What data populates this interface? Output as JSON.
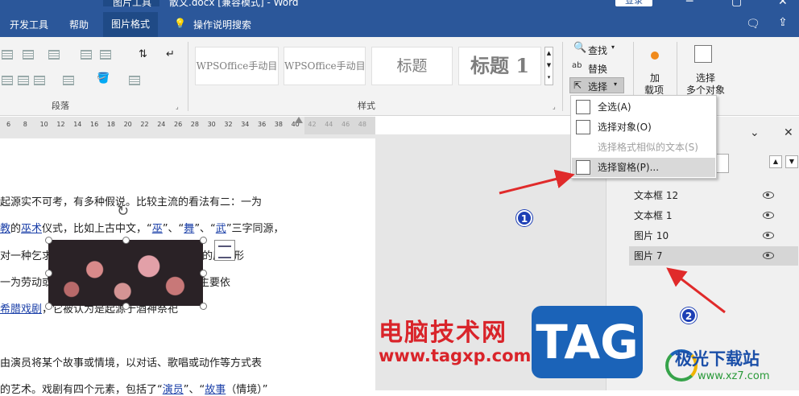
{
  "titlebar": {
    "title": "散文.docx [兼容模式] - Word",
    "context_tab": "图片工具",
    "login": "登录"
  },
  "tabs": [
    "开发工具",
    "帮助",
    "图片格式",
    "操作说明搜索"
  ],
  "ribbon": {
    "paragraph_label": "段落",
    "styles_label": "样式",
    "styles": [
      "WPSOffice手动目",
      "WPSOffice手动目",
      "标题",
      "标题 1"
    ],
    "find": "查找",
    "replace": "替换",
    "select": "选择",
    "addin_line1": "加",
    "addin_line2": "载项",
    "select_multi_line1": "选择",
    "select_multi_line2": "多个对象"
  },
  "ruler": {
    "ticks": [
      "6",
      "8",
      "10",
      "12",
      "14",
      "16",
      "18",
      "20",
      "22",
      "24",
      "26",
      "28",
      "30",
      "32",
      "34",
      "36",
      "38",
      "40",
      "42",
      "44",
      "46",
      "48"
    ]
  },
  "document": {
    "lines": [
      {
        "parts": [
          {
            "t": "起源实不可考，有多种假说。比较主流的看法有二：一为"
          }
        ]
      },
      {
        "parts": [
          {
            "t": "教",
            "link": true
          },
          {
            "t": "的"
          },
          {
            "t": "巫术",
            "link": true
          },
          {
            "t": "仪式，比如上古中文，“"
          },
          {
            "t": "巫",
            "link": true
          },
          {
            "t": "”、“"
          },
          {
            "t": "舞",
            "link": true
          },
          {
            "t": "”、“"
          },
          {
            "t": "武",
            "link": true
          },
          {
            "t": "”三字同源，"
          }
        ]
      },
      {
        "parts": [
          {
            "t": "对一种乞求战斗胜利的"
          },
          {
            "t": "巫术",
            "link": true
          },
          {
            "t": "活动的含称，         剧的原始形"
          }
        ]
      },
      {
        "parts": [
          {
            "t": "一为劳动或庆祝丰收的歌舞表演，这种说法主要依"
          }
        ]
      },
      {
        "parts": [
          {
            "t": "希腊戏剧",
            "link": true
          },
          {
            "t": "，它被认为是起源于酒神祭祀"
          }
        ]
      },
      {
        "parts": [
          {
            "t": "由演员将某个故事或情境，以对话、歌唱或动作等方式表"
          }
        ]
      },
      {
        "parts": [
          {
            "t": "的艺术。戏剧有四个元素，包括了“"
          },
          {
            "t": "演员",
            "link": true
          },
          {
            "t": "”、“"
          },
          {
            "t": "故事",
            "link": true
          },
          {
            "t": "（情境）”"
          }
        ]
      }
    ]
  },
  "select_menu": {
    "items": [
      {
        "label": "全选(A)",
        "disabled": false
      },
      {
        "label": "选择对象(O)",
        "disabled": false
      },
      {
        "label": "选择格式相似的文本(S)",
        "disabled": true
      },
      {
        "label": "选择窗格(P)...",
        "disabled": false
      }
    ]
  },
  "selection_pane": {
    "items": [
      {
        "label": "文本框 12",
        "selected": false
      },
      {
        "label": "文本框 1",
        "selected": false
      },
      {
        "label": "图片 10",
        "selected": false
      },
      {
        "label": "图片 7",
        "selected": true
      }
    ]
  },
  "annotations": {
    "one": "1",
    "two": "2"
  },
  "watermark": {
    "site_cn": "电脑技术网",
    "site_url": "www.tagxp.com",
    "tag": "TAG",
    "brand2": "极光下载站",
    "brand2_url": "www.xz7.com"
  },
  "colors": {
    "titlebar": "#2b579a",
    "accent_red": "#d9242a",
    "annotation_blue": "#1d3fb5"
  }
}
